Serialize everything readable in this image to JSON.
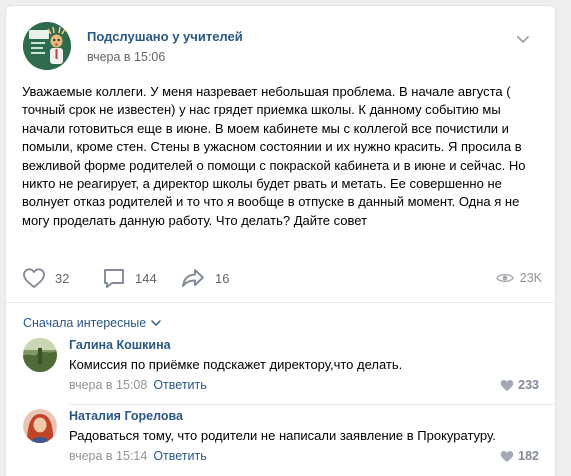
{
  "post": {
    "author": "Подслушано у учителей",
    "time": "вчера в 15:06",
    "text": "Уважаемые коллеги. У меня назревает небольшая проблема. В начале августа ( точный срок не известен) у нас грядет приемка школы. К данному событию мы начали готовиться еще в июне. В моем кабинете мы с коллегой все почистили и помыли, кроме стен. Стены в ужасном состоянии и их нужно красить. Я просила в вежливой форме родителей о помощи с покраской кабинета и в июне и сейчас. Но никто не реагирует, а директор школы будет рвать и метать. Ее совершенно не волнует отказ родителей и то что я вообще в отпуске в данный момент. Одна я не могу проделать данную работу. Что делать? Дайте совет",
    "likes": "32",
    "comments": "144",
    "shares": "16",
    "views": "23K"
  },
  "comments_section": {
    "sort_label": "Сначала интересные",
    "items": [
      {
        "author": "Галина Кошкина",
        "text": "Комиссия по приёмке подскажет директору,что делать.",
        "time": "вчера в 15:08",
        "reply": "Ответить",
        "likes": "233"
      },
      {
        "author": "Наталия Горелова",
        "text": "Радоваться тому, что родители не написали заявление в Прокуратуру.",
        "time": "вчера в 15:14",
        "reply": "Ответить",
        "likes": "182"
      }
    ]
  },
  "colors": {
    "link": "#2a5885",
    "muted": "#656565",
    "background": "#edeef0",
    "icon_gray": "#828a99"
  }
}
